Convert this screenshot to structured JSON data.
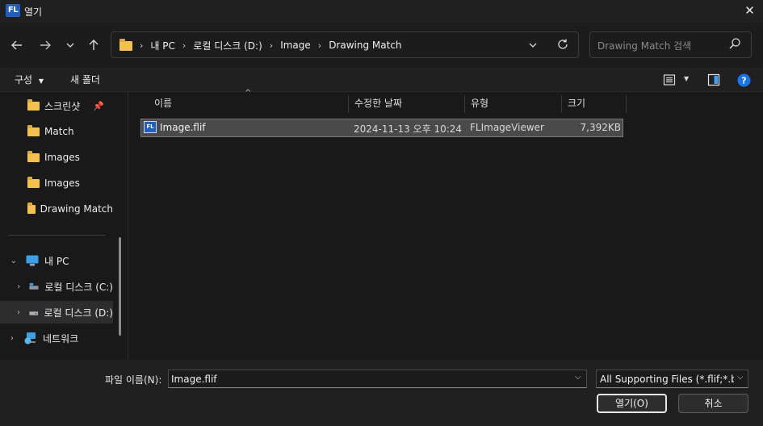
{
  "window": {
    "app_logo": "FL",
    "title": "열기"
  },
  "nav": {
    "back_icon": "arrow-left-icon",
    "forward_icon": "arrow-right-icon",
    "recent_icon": "chevron-down-icon",
    "up_icon": "arrow-up-icon",
    "breadcrumbs": [
      "내 PC",
      "로컬 디스크 (D:)",
      "Image",
      "Drawing Match"
    ],
    "search_placeholder": "Drawing Match 검색"
  },
  "toolbar": {
    "organize": "구성",
    "new_folder": "새 폴더"
  },
  "sidebar": {
    "quick_access": [
      {
        "label": "스크린샷",
        "pinned": true
      },
      {
        "label": "Match"
      },
      {
        "label": "Images"
      },
      {
        "label": "Images"
      },
      {
        "label": "Drawing Match"
      }
    ],
    "this_pc": "내 PC",
    "drives": [
      "로컬 디스크 (C:)",
      "로컬 디스크 (D:)"
    ],
    "network": "네트워크"
  },
  "columns": {
    "name": "이름",
    "modified": "수정한 날짜",
    "type": "유형",
    "size": "크기"
  },
  "files": [
    {
      "name": "Image.flif",
      "modified": "2024-11-13 오후 10:24",
      "type": "FLImageViewer",
      "size": "7,392KB",
      "icon_text": "FL"
    }
  ],
  "footer": {
    "filename_label": "파일 이름(N):",
    "filename_value": "Image.flif",
    "filetype_value": "All Supporting Files (*.flif;*.bmp",
    "open_button": "열기(O)",
    "cancel_button": "취소"
  },
  "colors": {
    "accent": "#1f5fc2",
    "folder": "#f2c14e",
    "help": "#1a73e8"
  }
}
